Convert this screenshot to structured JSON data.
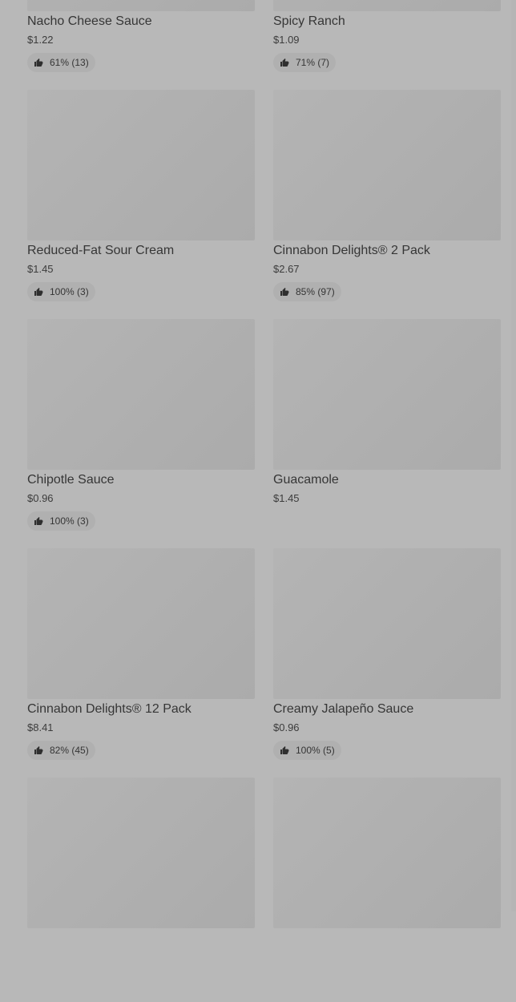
{
  "items": [
    {
      "title": "Nacho Cheese Sauce",
      "price": "$1.22",
      "rating": "61% (13)",
      "has_rating": true
    },
    {
      "title": "Spicy Ranch",
      "price": "$1.09",
      "rating": "71% (7)",
      "has_rating": true
    },
    {
      "title": "Reduced-Fat Sour Cream",
      "price": "$1.45",
      "rating": "100% (3)",
      "has_rating": true
    },
    {
      "title": "Cinnabon Delights® 2 Pack",
      "price": "$2.67",
      "rating": "85% (97)",
      "has_rating": true
    },
    {
      "title": "Chipotle Sauce",
      "price": "$0.96",
      "rating": "100% (3)",
      "has_rating": true
    },
    {
      "title": "Guacamole",
      "price": "$1.45",
      "rating": "",
      "has_rating": false
    },
    {
      "title": "Cinnabon Delights® 12 Pack",
      "price": "$8.41",
      "rating": "82% (45)",
      "has_rating": true
    },
    {
      "title": "Creamy Jalapeño Sauce",
      "price": "$0.96",
      "rating": "100% (5)",
      "has_rating": true
    },
    {
      "title": "",
      "price": "",
      "rating": "",
      "has_rating": false
    },
    {
      "title": "",
      "price": "",
      "rating": "",
      "has_rating": false
    }
  ],
  "colors": {
    "background": "#b8b8b8",
    "thumbnail": "#b0b0b0",
    "rating_pill": "#b0b0b0",
    "text": "#363636"
  },
  "icons": {
    "rating": "thumbs-up-icon"
  }
}
